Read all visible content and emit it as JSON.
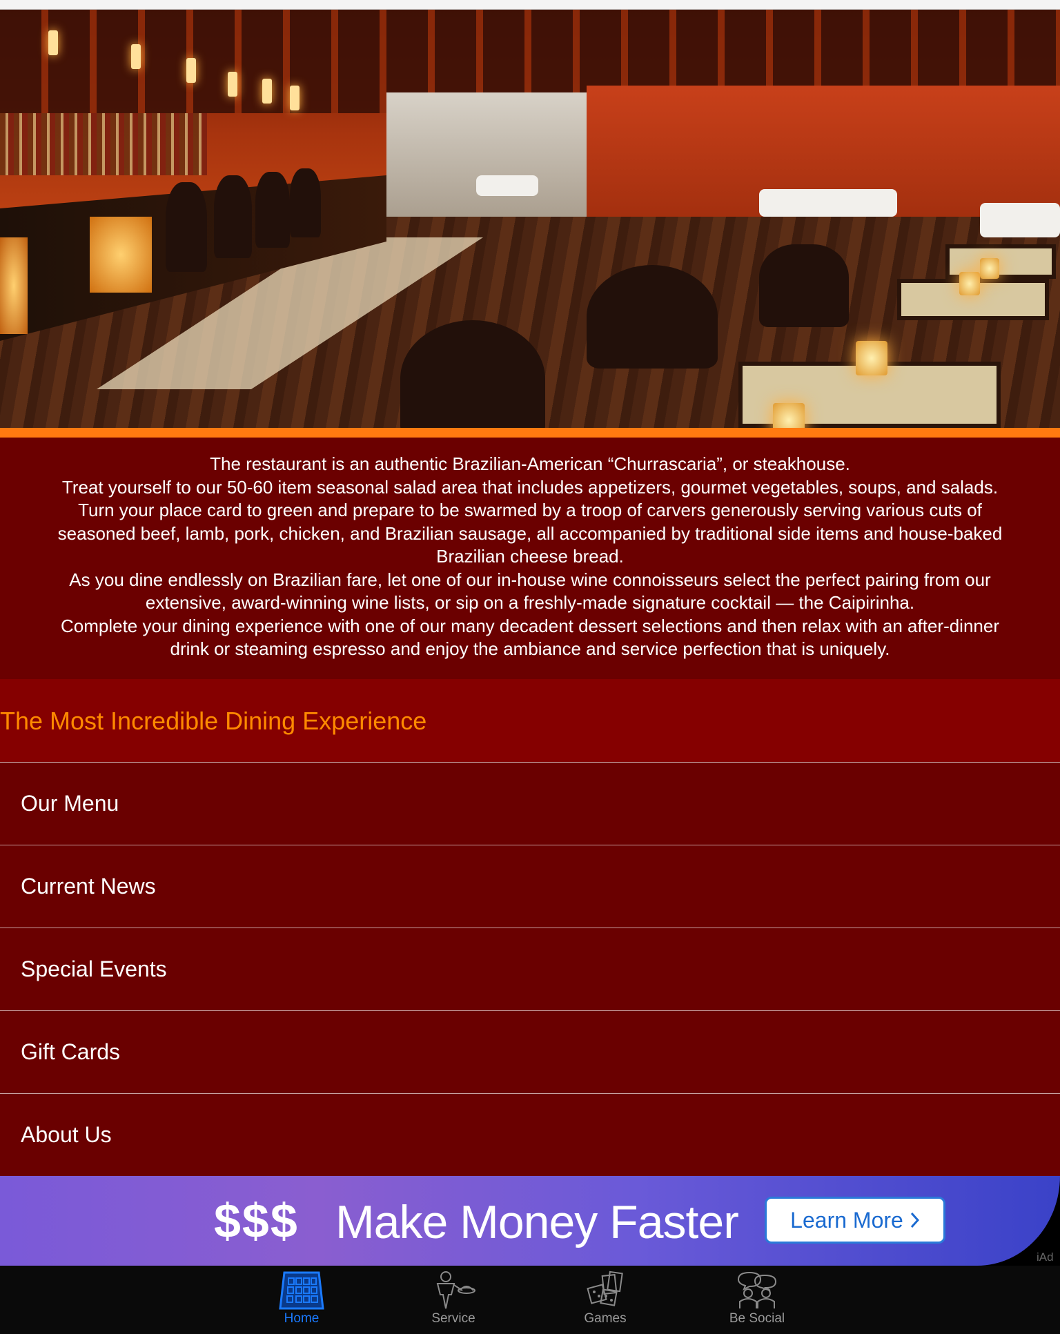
{
  "intro": {
    "lines": [
      "The restaurant is an authentic Brazilian-American “Churrascaria”, or steakhouse.",
      "Treat yourself to our 50-60 item seasonal salad area that includes appetizers, gourmet vegetables, soups, and salads.",
      "Turn your place card to green and prepare to be swarmed by a troop of carvers generously serving various cuts of",
      "seasoned beef, lamb, pork, chicken, and Brazilian sausage, all accompanied by traditional side items and house-baked",
      "Brazilian cheese bread.",
      "As you dine endlessly on Brazilian fare, let one of our in-house wine connoisseurs select the perfect pairing from our",
      "extensive, award-winning wine lists, or sip on a freshly-made signature cocktail — the Caipirinha.",
      "Complete your dining experience with one of our many decadent dessert selections and then relax with an after-dinner",
      "drink or steaming espresso and enjoy the ambiance and service perfection that is uniquely."
    ]
  },
  "headline": "The Most Incredible Dining Experience",
  "menu": {
    "items": [
      {
        "label": "Our Menu"
      },
      {
        "label": "Current News"
      },
      {
        "label": "Special Events"
      },
      {
        "label": "Gift Cards"
      },
      {
        "label": "About Us"
      }
    ]
  },
  "ad": {
    "dollars": "$$$",
    "text": "Make Money Faster",
    "button_label": "Learn More",
    "badge": "iAd"
  },
  "tabbar": {
    "tabs": [
      {
        "label": "Home",
        "icon": "home-building-icon"
      },
      {
        "label": "Service",
        "icon": "waiter-icon"
      },
      {
        "label": "Games",
        "icon": "dice-cards-icon"
      },
      {
        "label": "Be Social",
        "icon": "people-chat-icon"
      }
    ],
    "active": "Home",
    "active_color": "#1a7aff"
  },
  "colors": {
    "accent_orange": "#ff7a10",
    "intro_bg": "#6b0000",
    "menu_bg": "#6a0000",
    "headline_color": "#ff8a00"
  }
}
